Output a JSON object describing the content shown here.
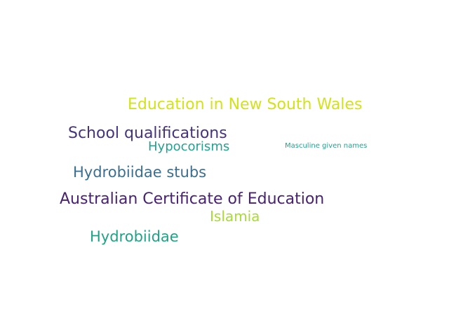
{
  "words": [
    {
      "text": "Education in New South Wales",
      "color": "#d2e21b"
    },
    {
      "text": "School qualifications",
      "color": "#46327e"
    },
    {
      "text": "Hypocorisms",
      "color": "#25a18e"
    },
    {
      "text": "Masculine given names",
      "color": "#2a9d8f"
    },
    {
      "text": "Hydrobiidae stubs",
      "color": "#3b6e8f"
    },
    {
      "text": "Australian Certificate of Education",
      "color": "#482173"
    },
    {
      "text": "Islamia",
      "color": "#a8db34"
    },
    {
      "text": "Hydrobiidae",
      "color": "#22a185"
    }
  ]
}
